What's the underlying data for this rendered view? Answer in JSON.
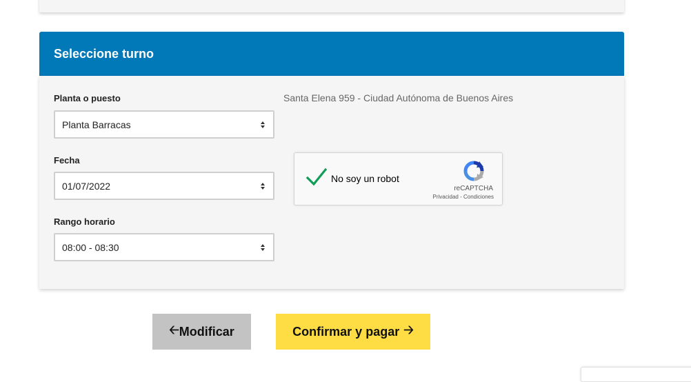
{
  "section": {
    "title": "Seleccione turno"
  },
  "location_field": {
    "label": "Planta o puesto",
    "value": "Planta Barracas"
  },
  "address": "Santa Elena 959 - Ciudad Autónoma de Buenos Aires",
  "date_field": {
    "label": "Fecha",
    "value": "01/07/2022"
  },
  "time_field": {
    "label": "Rango horario",
    "value": "08:00 - 08:30"
  },
  "recaptcha": {
    "label": "No soy un robot",
    "brand": "reCAPTCHA",
    "links": "Privacidad - Condiciones",
    "checked": true,
    "check_color": "#0f9d58"
  },
  "buttons": {
    "modify": {
      "label": "Modificar",
      "icon": "arrow-left-icon"
    },
    "confirm": {
      "label": "Confirmar y pagar",
      "icon": "arrow-right-icon"
    }
  },
  "colors": {
    "header_bg": "#0178b8",
    "confirm_bg": "#fddc44",
    "modify_bg": "#c3c3c3",
    "panel_bg": "#f5f5f5"
  }
}
